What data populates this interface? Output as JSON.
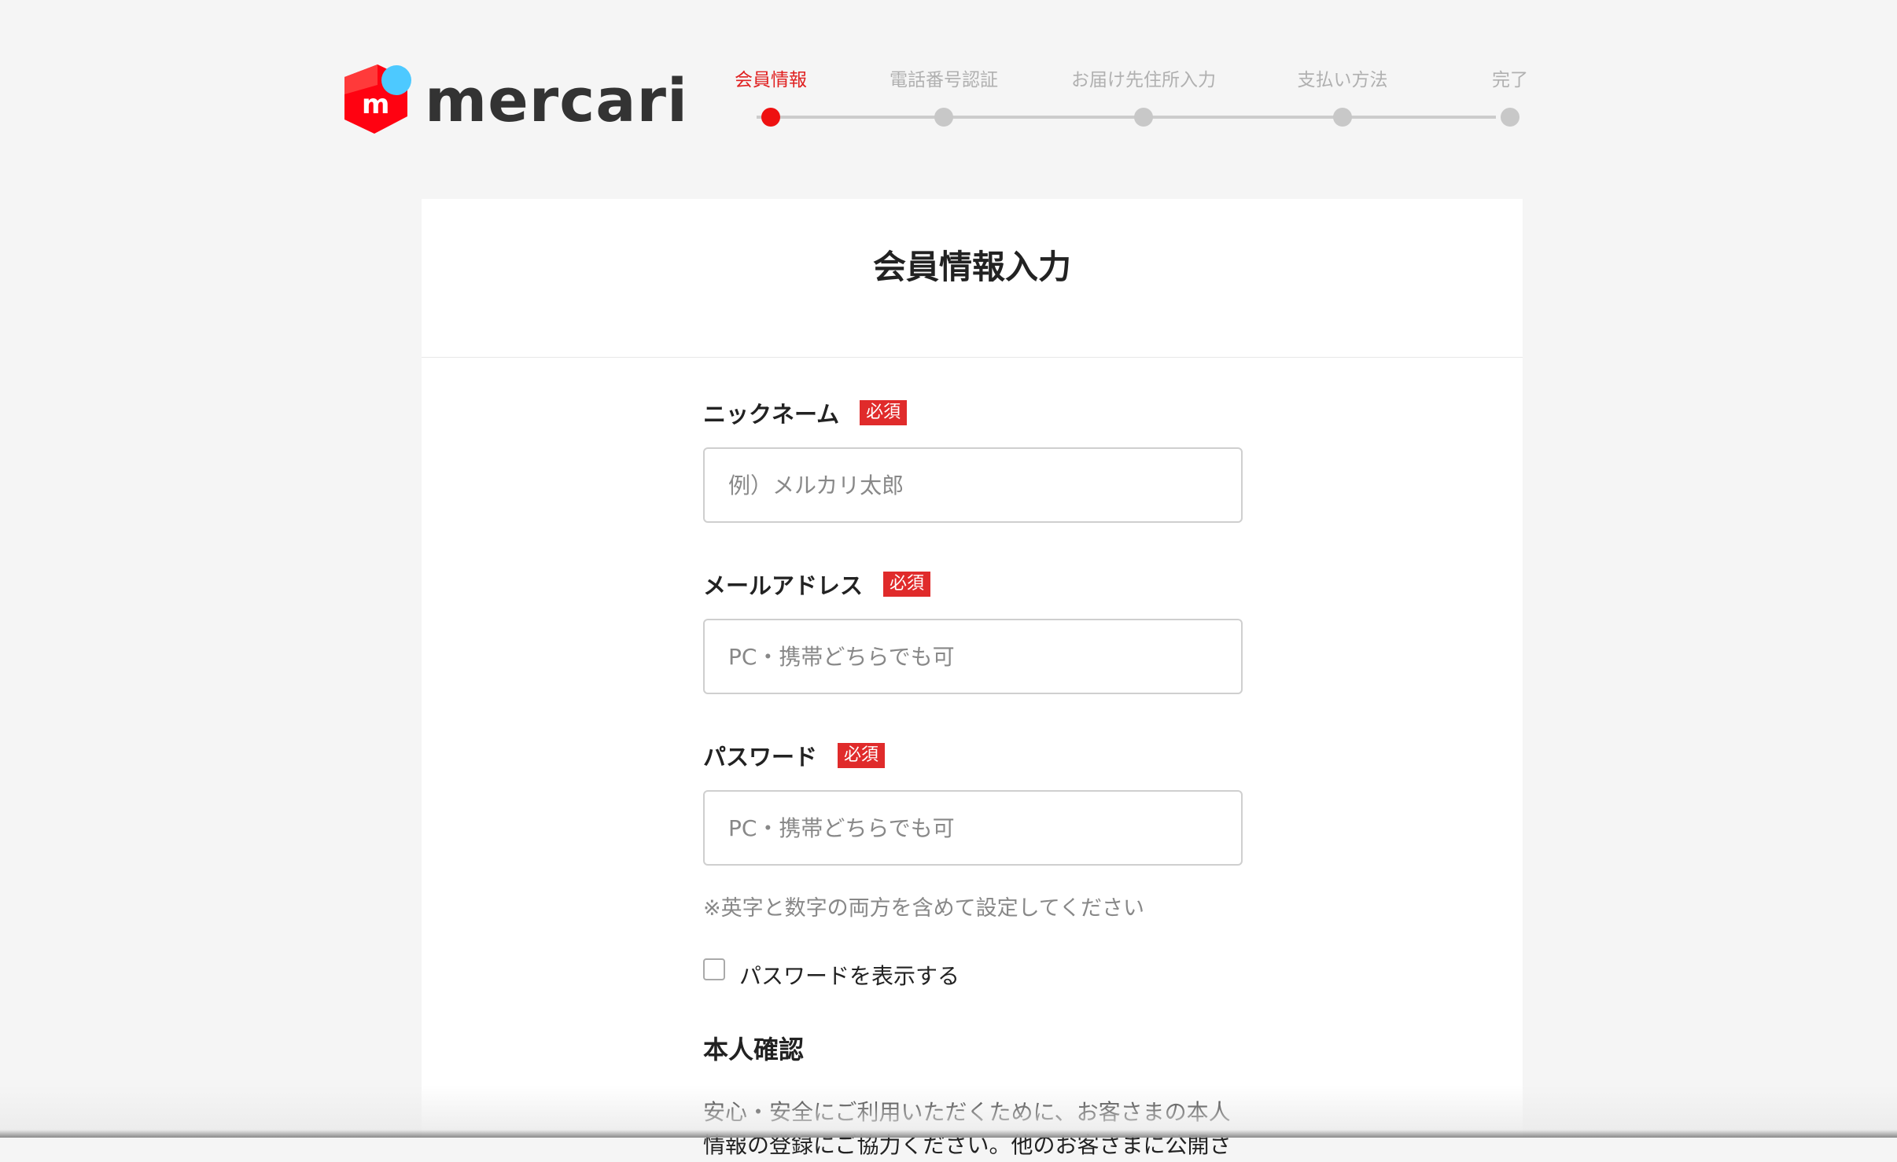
{
  "brand": {
    "name": "mercari",
    "mark_letter": "m",
    "colors": {
      "red": "#ff0211",
      "blue": "#4dc9ff"
    }
  },
  "steps": [
    {
      "label": "会員情報",
      "active": true
    },
    {
      "label": "電話番号認証",
      "active": false
    },
    {
      "label": "お届け先住所入力",
      "active": false
    },
    {
      "label": "支払い方法",
      "active": false
    },
    {
      "label": "完了",
      "active": false
    }
  ],
  "card": {
    "title": "会員情報入力"
  },
  "form": {
    "required_badge": "必須",
    "nickname": {
      "label": "ニックネーム",
      "placeholder": "例）メルカリ太郎",
      "value": ""
    },
    "email": {
      "label": "メールアドレス",
      "placeholder": "PC・携帯どちらでも可",
      "value": ""
    },
    "password": {
      "label": "パスワード",
      "placeholder": "PC・携帯どちらでも可",
      "value": ""
    },
    "password_hint": "※英字と数字の両方を含めて設定してください",
    "show_password_label": "パスワードを表示する",
    "identity": {
      "title": "本人確認",
      "text": "安心・安全にご利用いただくために、お客さまの本人情報の登録にご協力ください。他のお客さまに公開さ"
    }
  }
}
